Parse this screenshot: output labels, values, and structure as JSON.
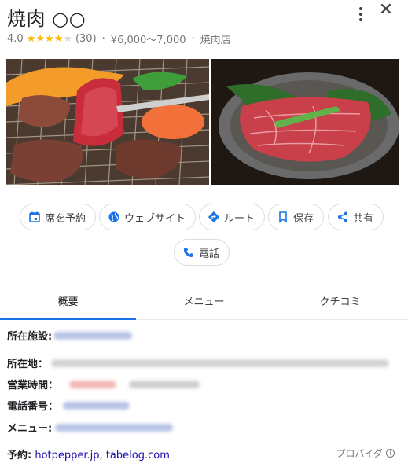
{
  "place": {
    "title": "焼肉 ○○",
    "rating": "4.0",
    "stars_filled": 4,
    "stars_total": 5,
    "review_count": "(30)",
    "price": "¥6,000〜7,000",
    "category": "焼肉店",
    "separator": "·"
  },
  "header": {
    "more_icon": "more-vert-icon",
    "close_label": "✕"
  },
  "actions": {
    "reserve": "席を予約",
    "website": "ウェブサイト",
    "route": "ルート",
    "save": "保存",
    "share": "共有",
    "phone": "電話"
  },
  "tabs": [
    {
      "label": "概要",
      "active": true
    },
    {
      "label": "メニュー",
      "active": false
    },
    {
      "label": "クチコミ",
      "active": false
    }
  ],
  "info": {
    "facility_label": "所在施設:",
    "address_label": "所在地：",
    "hours_label": "営業時間：",
    "phone_label": "電話番号：",
    "menu_label": "メニュー:"
  },
  "reserve": {
    "label": "予約:",
    "link1": "hotpepper.jp",
    "comma": ",",
    "link2": "tabelog.com"
  },
  "provider": {
    "label": "プロバイダ",
    "icon": "info-icon"
  },
  "colors": {
    "accent": "#1a73e8",
    "star": "#fbbc04",
    "link": "#1a0dab",
    "muted": "#70757a"
  }
}
